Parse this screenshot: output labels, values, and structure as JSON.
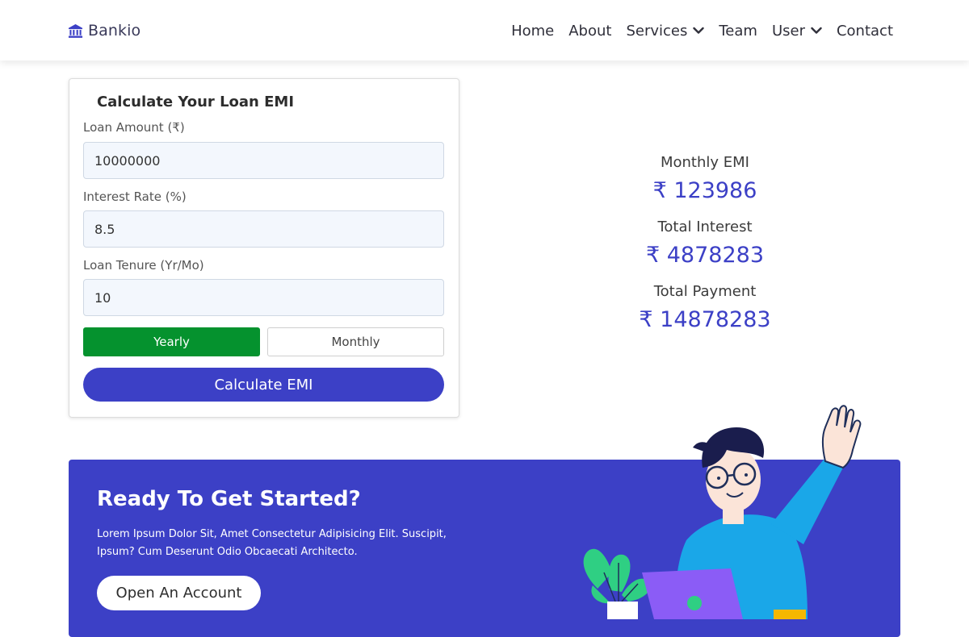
{
  "header": {
    "brand": "Bankio",
    "nav": [
      {
        "label": "Home",
        "dropdown": false
      },
      {
        "label": "About",
        "dropdown": false
      },
      {
        "label": "Services",
        "dropdown": true
      },
      {
        "label": "Team",
        "dropdown": false
      },
      {
        "label": "User",
        "dropdown": true
      },
      {
        "label": "Contact",
        "dropdown": false
      }
    ]
  },
  "calculator": {
    "title": "Calculate Your Loan EMI",
    "amount_label": "Loan Amount (₹)",
    "amount_value": "10000000",
    "rate_label": "Interest Rate (%)",
    "rate_value": "8.5",
    "tenure_label": "Loan Tenure (Yr/Mo)",
    "tenure_value": "10",
    "yearly_label": "Yearly",
    "monthly_label": "Monthly",
    "selected_tenure_mode": "Yearly",
    "calculate_label": "Calculate EMI"
  },
  "results": {
    "emi_label": "Monthly EMI",
    "emi_value": "₹ 123986",
    "interest_label": "Total Interest",
    "interest_value": "₹ 4878283",
    "payment_label": "Total Payment",
    "payment_value": "₹ 14878283"
  },
  "cta": {
    "title": "Ready To Get Started?",
    "text": "Lorem Ipsum Dolor Sit, Amet Consectetur Adipisicing Elit. Suscipit, Ipsum? Cum Deserunt Odio Obcaecati Architecto.",
    "button": "Open An Account"
  },
  "colors": {
    "accent": "#3c40c6",
    "active_toggle": "#05922e",
    "input_bg": "#f3f7fd"
  },
  "icons": {
    "brand": "bank-building-icon",
    "dropdown": "chevron-down-icon"
  }
}
